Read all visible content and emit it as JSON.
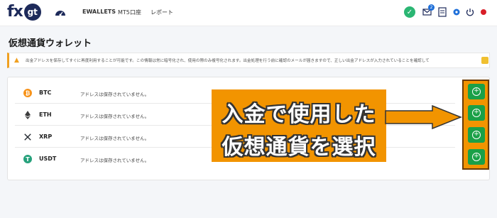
{
  "header": {
    "logo_text": "fx",
    "logo_badge": "gt",
    "nav": [
      {
        "label": "EWALLETS"
      },
      {
        "label": "MT5口座"
      },
      {
        "label": "レポート"
      }
    ],
    "notification_count": "2",
    "icons": [
      "check-icon",
      "mail-icon",
      "document-icon",
      "gear-icon",
      "power-icon",
      "flag-icon"
    ]
  },
  "page": {
    "title": "仮想通貨ウォレット"
  },
  "alert": {
    "text": "出金アドレスを保存してすぐに再度利用することが可能です。この情報は常に暗号化され、使用の際のみ複号化されます。出金処理を行う前に確認のメールが届きますので、正しい出金アドレスが入力されていることを確認して"
  },
  "wallets": [
    {
      "symbol": "BTC",
      "status": "アドレスは保存されていません。",
      "icon": "bitcoin-icon",
      "color": "#f7931a"
    },
    {
      "symbol": "ETH",
      "status": "アドレスは保存されていません。",
      "icon": "ethereum-icon",
      "color": "#3c3c3d"
    },
    {
      "symbol": "XRP",
      "status": "アドレスは保存されていません。",
      "icon": "xrp-icon",
      "color": "#23292f"
    },
    {
      "symbol": "USDT",
      "status": "アドレスは保存されていません。",
      "icon": "tether-icon",
      "color": "#26a17b"
    }
  ],
  "callout": {
    "line1": "入金で使用した",
    "line2": "仮想通貨を選択",
    "color": "#f29400"
  },
  "colors": {
    "accent_green": "#1aa047",
    "brand_navy": "#1d2a5a",
    "warning": "#f0a020"
  }
}
